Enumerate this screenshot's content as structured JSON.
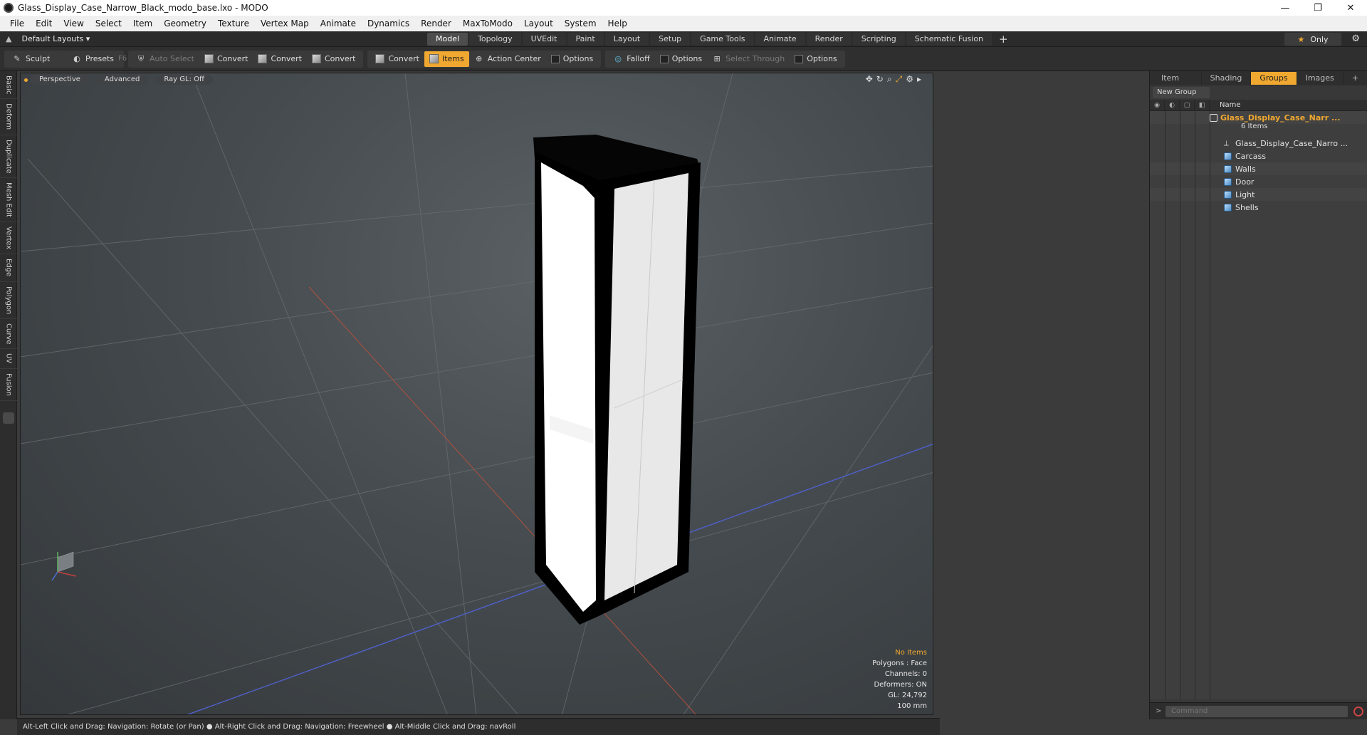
{
  "window": {
    "title": "Glass_Display_Case_Narrow_Black_modo_base.lxo - MODO",
    "min": "—",
    "max": "❐",
    "close": "✕"
  },
  "menu": [
    "File",
    "Edit",
    "View",
    "Select",
    "Item",
    "Geometry",
    "Texture",
    "Vertex Map",
    "Animate",
    "Dynamics",
    "Render",
    "MaxToModo",
    "Layout",
    "System",
    "Help"
  ],
  "layout": {
    "label": "Default Layouts ▾"
  },
  "tabs": [
    "Model",
    "Topology",
    "UVEdit",
    "Paint",
    "Layout",
    "Setup",
    "Game Tools",
    "Animate",
    "Render",
    "Scripting",
    "Schematic Fusion"
  ],
  "only_label": "Only",
  "toolbar": {
    "sculpt": "Sculpt",
    "presets": "Presets",
    "presets_shortcut": "F6",
    "auto_select": "Auto Select",
    "convert1": "Convert",
    "convert2": "Convert",
    "convert3": "Convert",
    "convert4": "Convert",
    "items": "Items",
    "action_center": "Action Center",
    "options1": "Options",
    "falloff": "Falloff",
    "options2": "Options",
    "select_through": "Select Through",
    "options3": "Options"
  },
  "left_tabs": [
    "Basic",
    "Deform",
    "Duplicate",
    "Mesh Edit",
    "Vertex",
    "Edge",
    "Polygon",
    "Curve",
    "UV",
    "Fusion"
  ],
  "viewport": {
    "perspective": "Perspective",
    "advanced": "Advanced",
    "raygl": "Ray GL: Off",
    "stats": {
      "no_items": "No Items",
      "polygons": "Polygons : Face",
      "channels": "Channels: 0",
      "deformers": "Deformers: ON",
      "gl": "GL: 24,792",
      "scale": "100 mm"
    }
  },
  "statusbar": "Alt-Left Click and Drag: Navigation: Rotate (or Pan) ● Alt-Right Click and Drag: Navigation: Freewheel ● Alt-Middle Click and Drag: navRoll",
  "right_panel": {
    "tabs": [
      "Item List",
      "Shading",
      "Groups",
      "Images"
    ],
    "new_group": "New Group",
    "name_header": "Name",
    "group_name": "Glass_Display_Case_Narr ...",
    "group_count": "6 Items",
    "items": [
      "Glass_Display_Case_Narro ...",
      "Carcass",
      "Walls",
      "Door",
      "Light",
      "Shells"
    ],
    "command_placeholder": "Command"
  }
}
